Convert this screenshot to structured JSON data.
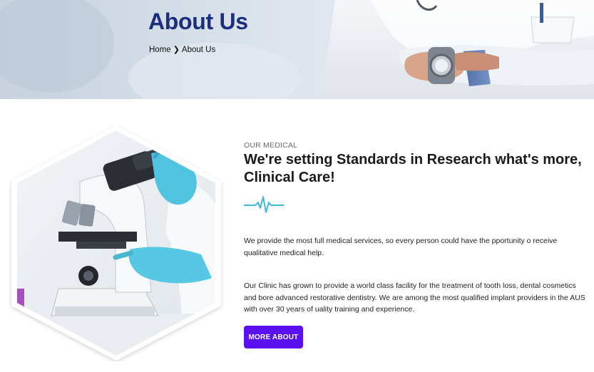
{
  "hero": {
    "title": "About Us",
    "breadcrumb": {
      "home": "Home",
      "separator": "❯",
      "current": "About Us"
    }
  },
  "about": {
    "eyebrow": "OUR MEDICAL",
    "headline": "We're setting Standards in Research what's more, Clinical Care!",
    "paragraph_1": "We provide the most full medical services, so every person could have the pportunity o receive qualitative medical help.",
    "paragraph_2": "Our Clinic has grown to provide a world class facility for the treatment of tooth loss, dental cosmetics and bore advanced restorative dentistry. We are among the most qualified implant providers in the AUS with over 30 years of uality training and experience.",
    "button_label": "MORE ABOUT"
  },
  "colors": {
    "title_blue": "#1b2f7e",
    "accent_cyan": "#3fb7e0",
    "button_purple": "#5b10f2"
  }
}
